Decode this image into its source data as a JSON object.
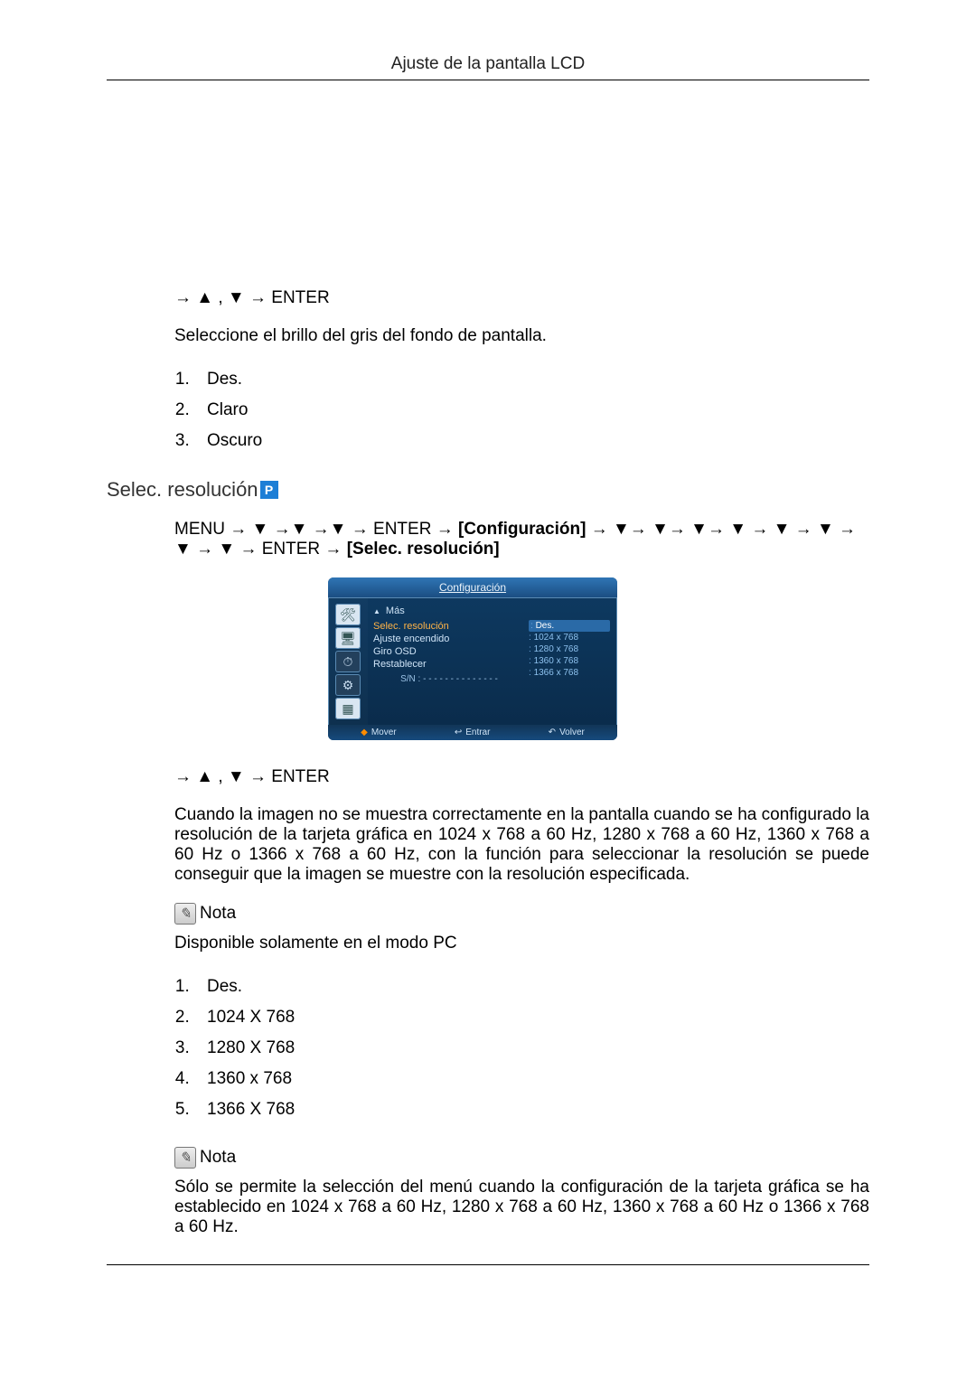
{
  "header": {
    "title": "Ajuste de la pantalla LCD"
  },
  "gray": {
    "nav": "→ ▲ , ▼ → ENTER",
    "description": "Seleccione el brillo del gris del fondo de pantalla.",
    "options": [
      "Des.",
      "Claro",
      "Oscuro"
    ]
  },
  "res": {
    "heading": "Selec. resolución",
    "nav1_prefix": "MENU → ▼ →▼ →▼ → ENTER → ",
    "nav1_bracket": "[Configuración]",
    "nav1_suffix": " → ▼→ ▼→ ▼→ ▼ → ▼ → ▼ → ▼ → ▼ → ENTER → ",
    "nav1_bracket2": "[Selec. resolución]",
    "nav2": "→ ▲ , ▼ → ENTER",
    "paragraph": "Cuando la imagen no se muestra correctamente en la pantalla cuando se ha configurado la resolución de la tarjeta gráfica en 1024 x 768 a 60 Hz, 1280 x 768 a 60 Hz, 1360 x 768 a 60 Hz o 1366 x 768 a 60 Hz, con la función para seleccionar la resolución se puede conseguir que la imagen se muestre con la resolución especificada.",
    "note_label": "Nota",
    "note1": "Disponible solamente en el modo PC",
    "options": [
      "Des.",
      "1024 X 768",
      "1280 X 768",
      "1360 x 768",
      "1366 X 768"
    ],
    "note2": "Sólo se permite la selección del menú cuando la configuración de la tarjeta gráfica se ha establecido en 1024 x 768 a 60 Hz, 1280 x 768 a 60 Hz, 1360 x 768 a 60 Hz o 1366 x 768 a 60 Hz."
  },
  "osd": {
    "title": "Configuración",
    "more": "Más",
    "menu": {
      "selected": "Selec. resolución",
      "items": [
        "Ajuste encendido",
        "Giro OSD",
        "Restablecer"
      ]
    },
    "values": [
      "Des.",
      "1024 x 768",
      "1280 x 768",
      "1360 x 768",
      "1366 x 768"
    ],
    "serial_label": "S/N :",
    "serial_value": "- - - - - - - - - - - - - -",
    "footer": {
      "move": "Mover",
      "enter": "Entrar",
      "back": "Volver"
    }
  }
}
